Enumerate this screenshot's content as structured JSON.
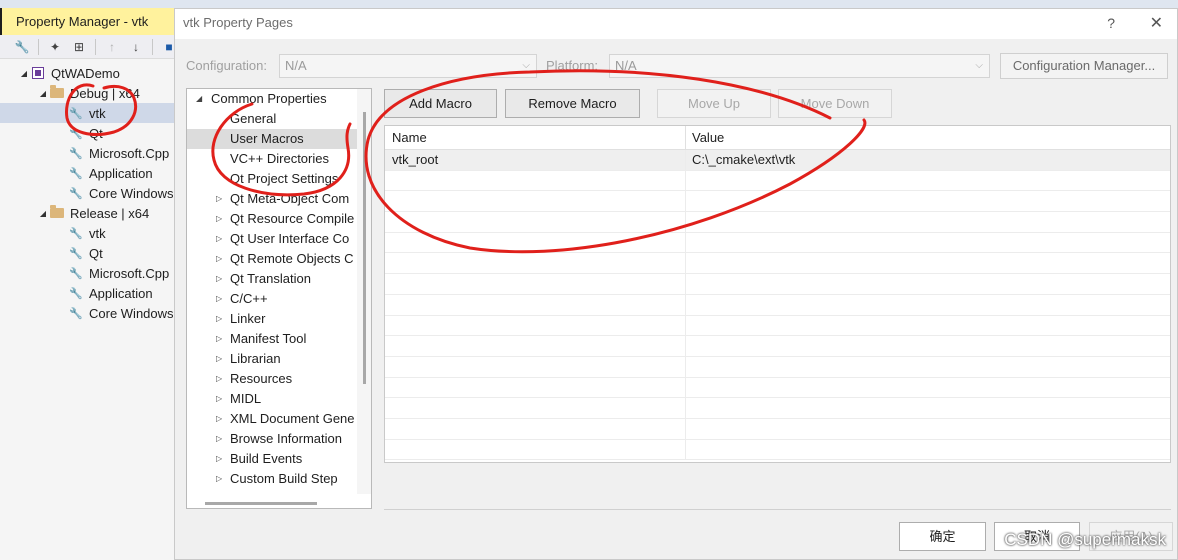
{
  "property_manager": {
    "title": "Property Manager - vtk",
    "toolbar_icons": [
      "wrench-icon",
      "wand-icon",
      "add-sheet-icon",
      "up-arrow-icon",
      "down-arrow-icon",
      "save-icon"
    ],
    "tree": [
      {
        "label": "QtWADemo",
        "icon": "project-icon"
      },
      {
        "label": "Debug | x64",
        "icon": "folder-icon"
      },
      {
        "label": "vtk",
        "icon": "wrench-icon",
        "selected": true
      },
      {
        "label": "Qt",
        "icon": "wrench-icon"
      },
      {
        "label": "Microsoft.Cpp",
        "icon": "wrench-icon"
      },
      {
        "label": "Application",
        "icon": "wrench-icon"
      },
      {
        "label": "Core Windows",
        "icon": "wrench-icon"
      },
      {
        "label": "Release | x64",
        "icon": "folder-icon"
      },
      {
        "label": "vtk",
        "icon": "wrench-icon"
      },
      {
        "label": "Qt",
        "icon": "wrench-icon"
      },
      {
        "label": "Microsoft.Cpp",
        "icon": "wrench-icon"
      },
      {
        "label": "Application",
        "icon": "wrench-icon"
      },
      {
        "label": "Core Windows",
        "icon": "wrench-icon"
      }
    ]
  },
  "dialog": {
    "title": "vtk Property Pages",
    "help": "?",
    "close": "✕",
    "configuration_label": "Configuration:",
    "configuration_value": "N/A",
    "platform_label": "Platform:",
    "platform_value": "N/A",
    "config_manager": "Configuration Manager...",
    "tree": [
      {
        "label": "Common Properties",
        "expanded": true
      },
      {
        "label": "General"
      },
      {
        "label": "User Macros",
        "selected": true
      },
      {
        "label": "VC++ Directories"
      },
      {
        "label": "Qt Project Settings"
      },
      {
        "label": "Qt Meta-Object Com",
        "collapsed": true
      },
      {
        "label": "Qt Resource Compile",
        "collapsed": true
      },
      {
        "label": "Qt User Interface Co",
        "collapsed": true
      },
      {
        "label": "Qt Remote Objects C",
        "collapsed": true
      },
      {
        "label": "Qt Translation",
        "collapsed": true
      },
      {
        "label": "C/C++",
        "collapsed": true
      },
      {
        "label": "Linker",
        "collapsed": true
      },
      {
        "label": "Manifest Tool",
        "collapsed": true
      },
      {
        "label": "Librarian",
        "collapsed": true
      },
      {
        "label": "Resources",
        "collapsed": true
      },
      {
        "label": "MIDL",
        "collapsed": true
      },
      {
        "label": "XML Document Gene",
        "collapsed": true
      },
      {
        "label": "Browse Information",
        "collapsed": true
      },
      {
        "label": "Build Events",
        "collapsed": true
      },
      {
        "label": "Custom Build Step",
        "collapsed": true
      }
    ],
    "buttons": {
      "add_macro": "Add Macro",
      "remove_macro": "Remove Macro",
      "move_up": "Move Up",
      "move_down": "Move Down"
    },
    "grid": {
      "columns": [
        "Name",
        "Value"
      ],
      "rows": [
        {
          "name": "vtk_root",
          "value": "C:\\_cmake\\ext\\vtk"
        }
      ]
    },
    "footer": {
      "ok": "确定",
      "cancel": "取消",
      "apply": "应用(A)"
    }
  },
  "watermark": "CSDN @supermaksk",
  "annotation_color": "#e0201b"
}
